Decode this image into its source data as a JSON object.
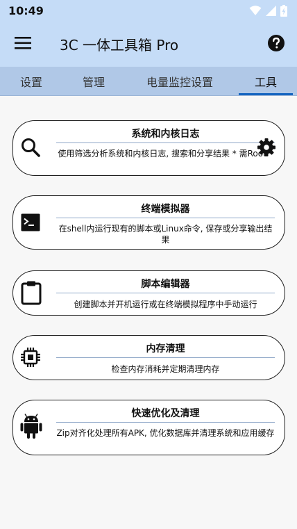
{
  "status_bar": {
    "time": "10:49"
  },
  "app_bar": {
    "title": "3C 一体工具箱 Pro"
  },
  "tabs": [
    {
      "label": "设置"
    },
    {
      "label": "管理"
    },
    {
      "label": "电量监控设置"
    },
    {
      "label": "工具"
    }
  ],
  "active_tab": "工具",
  "cards": [
    {
      "title": "系统和内核日志",
      "description": "使用筛选分析系统和内核日志, 搜索和分享结果 * 需Root *",
      "icon": "search-icon",
      "right_icon": "gear-icon"
    },
    {
      "title": "终端模拟器",
      "description": "在shell内运行现有的脚本或Linux命令, 保存或分享输出结果",
      "icon": "terminal-icon"
    },
    {
      "title": "脚本编辑器",
      "description": "创建脚本并开机运行或在终端模拟程序中手动运行",
      "icon": "clipboard-icon"
    },
    {
      "title": "内存清理",
      "description": "检查内存消耗并定期清理内存",
      "icon": "chip-icon"
    },
    {
      "title": "快速优化及清理",
      "description": "Zip对齐化处理所有APK, 优化数据库并清理系统和应用缓存",
      "icon": "android-icon"
    }
  ],
  "colors": {
    "app_bar": "#c5dcf7",
    "tab_bar": "#b0c8e7",
    "tab_indicator": "#1565c0",
    "card_border": "#1f1f1f"
  }
}
